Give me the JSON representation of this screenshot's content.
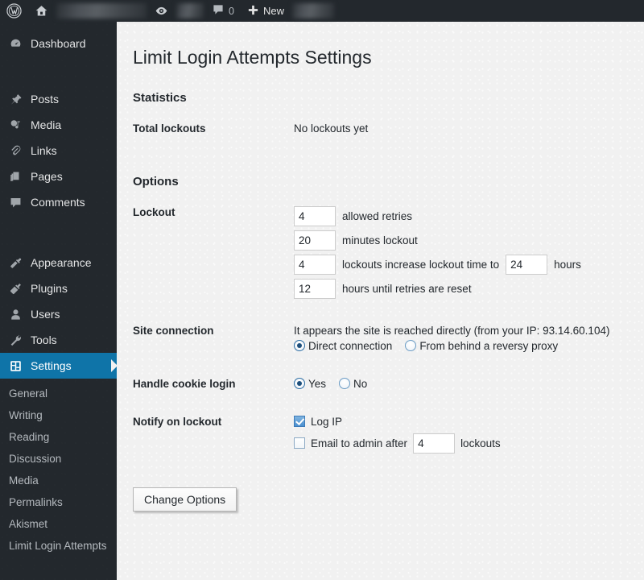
{
  "adminbar": {
    "logo_icon": "wordpress-logo-icon",
    "home_icon": "home-icon",
    "site_name_redacted": "",
    "visit_icon": "eye-icon",
    "comments_icon": "comment-bubble-icon",
    "comments_count": "0",
    "new_icon": "plus-icon",
    "new_label": "New",
    "account_redacted": ""
  },
  "sidebar": {
    "items": [
      {
        "label": "Dashboard",
        "icon": "dashboard-icon",
        "current": false
      },
      {
        "label": "Posts",
        "icon": "pin-icon",
        "current": false
      },
      {
        "label": "Media",
        "icon": "media-icon",
        "current": false
      },
      {
        "label": "Links",
        "icon": "link-icon",
        "current": false
      },
      {
        "label": "Pages",
        "icon": "pages-icon",
        "current": false
      },
      {
        "label": "Comments",
        "icon": "comment-icon",
        "current": false
      },
      {
        "label": "Appearance",
        "icon": "appearance-icon",
        "current": false
      },
      {
        "label": "Plugins",
        "icon": "plugins-icon",
        "current": false
      },
      {
        "label": "Users",
        "icon": "users-icon",
        "current": false
      },
      {
        "label": "Tools",
        "icon": "tools-icon",
        "current": false
      },
      {
        "label": "Settings",
        "icon": "settings-icon",
        "current": true
      }
    ],
    "submenu": [
      {
        "label": "General"
      },
      {
        "label": "Writing"
      },
      {
        "label": "Reading"
      },
      {
        "label": "Discussion"
      },
      {
        "label": "Media"
      },
      {
        "label": "Permalinks"
      },
      {
        "label": "Akismet"
      },
      {
        "label": "Limit Login Attempts"
      }
    ]
  },
  "page": {
    "title": "Limit Login Attempts Settings",
    "statistics_heading": "Statistics",
    "options_heading": "Options",
    "stats": {
      "total_lockouts_label": "Total lockouts",
      "total_lockouts_value": "No lockouts yet"
    },
    "lockout": {
      "label": "Lockout",
      "allowed_retries_value": "4",
      "allowed_retries_text": "allowed retries",
      "minutes_lockout_value": "20",
      "minutes_lockout_text": "minutes lockout",
      "lockouts_increase_value": "4",
      "lockouts_increase_text": "lockouts increase lockout time to",
      "increase_hours_value": "24",
      "increase_hours_text": "hours",
      "retries_reset_value": "12",
      "retries_reset_text": "hours until retries are reset"
    },
    "site_connection": {
      "label": "Site connection",
      "description": "It appears the site is reached directly (from your IP: 93.14.60.104)",
      "option_direct": "Direct connection",
      "option_proxy": "From behind a reversy proxy",
      "selected": "direct"
    },
    "cookie_login": {
      "label": "Handle cookie login",
      "option_yes": "Yes",
      "option_no": "No",
      "selected": "yes"
    },
    "notify": {
      "label": "Notify on lockout",
      "log_ip_label": "Log IP",
      "log_ip_checked": true,
      "email_admin_label": "Email to admin after",
      "email_admin_checked": false,
      "email_admin_value": "4",
      "email_admin_suffix": "lockouts"
    },
    "submit_label": "Change Options"
  },
  "colors": {
    "admin_blue": "#0f74a8",
    "sidebar_bg": "#23282d",
    "content_bg": "#f1f1f1"
  }
}
